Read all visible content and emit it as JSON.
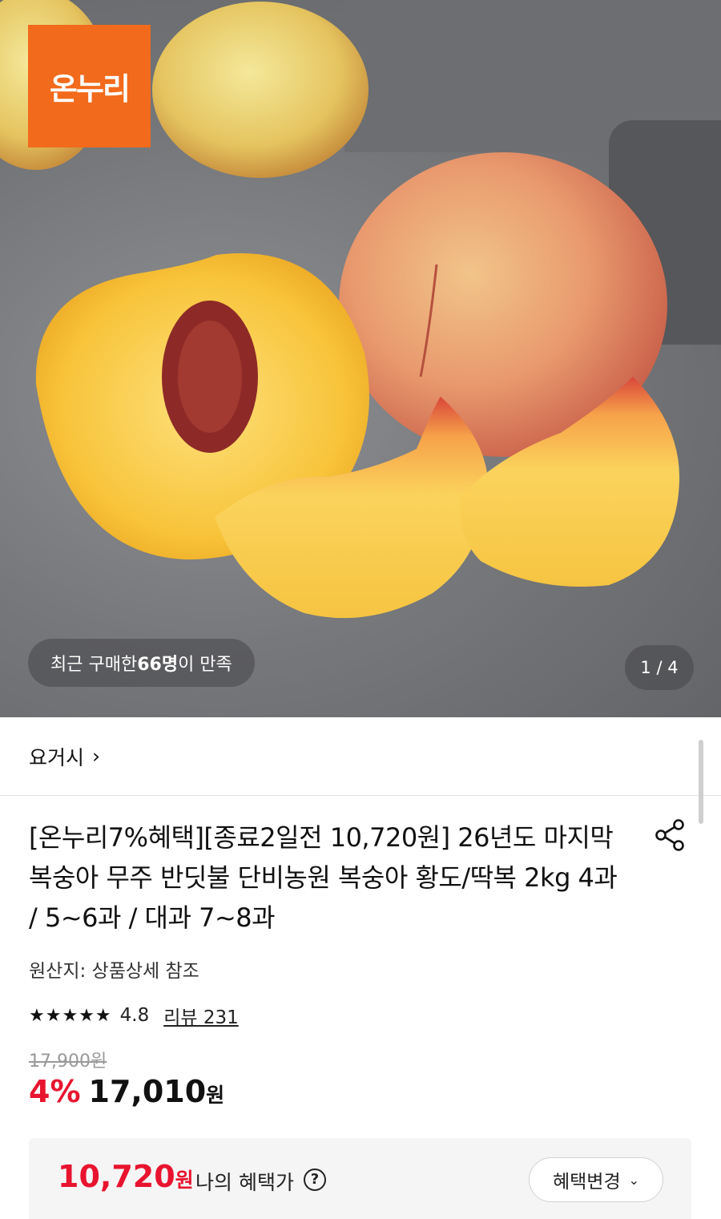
{
  "hero": {
    "brand_logo_text": "온누리",
    "buyer_prefix": "최근 구매한 ",
    "buyer_count": "66명",
    "buyer_suffix": "이 만족",
    "pager": "1 / 4"
  },
  "store": {
    "name": "요거시",
    "chevron": "›"
  },
  "product": {
    "title": "[온누리7%혜택][종료2일전 10,720원] 26년도 마지막 복숭아 무주 반딧불 단비농원 복숭아 황도/딱복 2kg 4과 / 5~6과 / 대과 7~8과",
    "origin": "원산지: 상품상세 참조",
    "stars": "★★★★★",
    "rating": "4.8",
    "reviews": "리뷰 231",
    "original_price": "17,900원",
    "discount": "4%",
    "sale_price": "17,010",
    "sale_unit": "원"
  },
  "benefit": {
    "price": "10,720",
    "unit": "원",
    "label": "나의 혜택가",
    "help_symbol": "?",
    "change_label": "혜택변경",
    "change_chevron": "⌄"
  },
  "icons": {
    "share": "share-icon",
    "help": "question-circle-icon",
    "chevron_right": "chevron-right-icon",
    "chevron_down": "chevron-down-icon"
  },
  "colors": {
    "accent_red": "#e8142f",
    "brand_orange": "#f26a1b"
  }
}
